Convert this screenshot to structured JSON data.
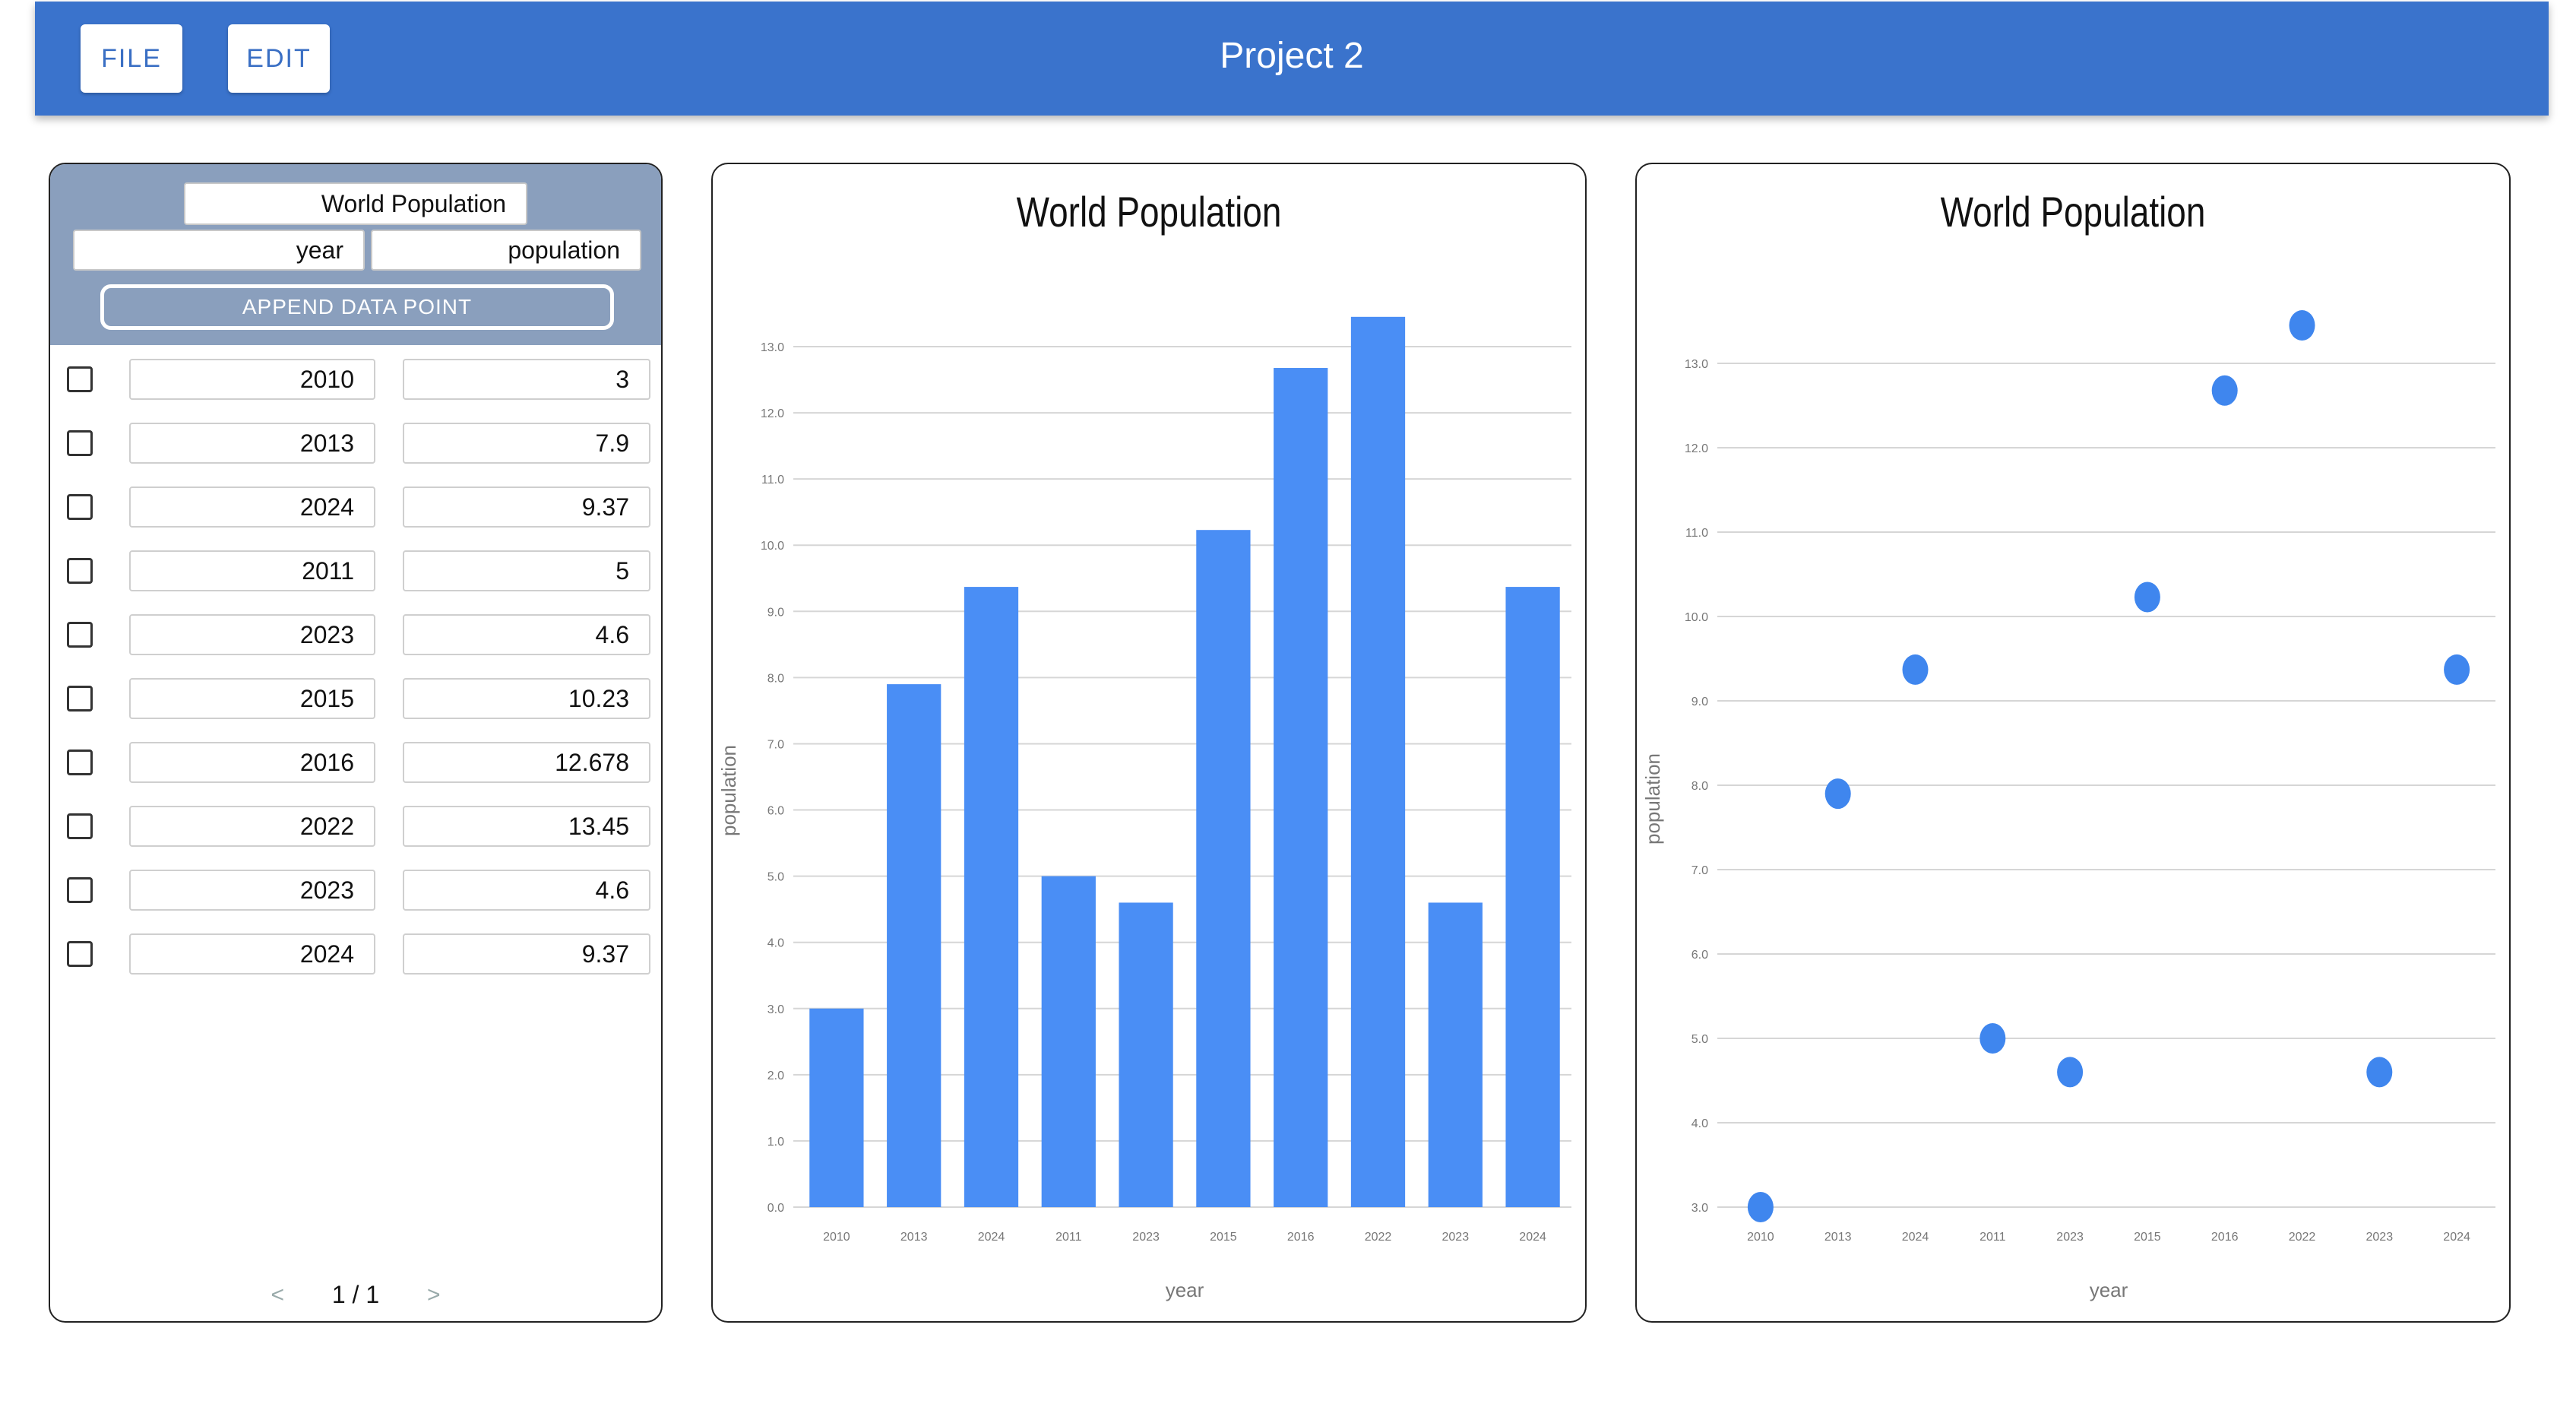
{
  "header": {
    "title": "Project 2",
    "menu": [
      {
        "label": "FILE"
      },
      {
        "label": "EDIT"
      }
    ]
  },
  "dataset": {
    "name": "World Population",
    "x_name": "year",
    "y_name": "population",
    "append_label": "APPEND DATA POINT",
    "rows": [
      {
        "x": "2010",
        "y": "3"
      },
      {
        "x": "2013",
        "y": "7.9"
      },
      {
        "x": "2024",
        "y": "9.37"
      },
      {
        "x": "2011",
        "y": "5"
      },
      {
        "x": "2023",
        "y": "4.6"
      },
      {
        "x": "2015",
        "y": "10.23"
      },
      {
        "x": "2016",
        "y": "12.678"
      },
      {
        "x": "2022",
        "y": "13.45"
      },
      {
        "x": "2023",
        "y": "4.6"
      },
      {
        "x": "2024",
        "y": "9.37"
      }
    ]
  },
  "pager": {
    "prev": "<",
    "page": "1 / 1",
    "next": ">"
  },
  "colors": {
    "accent": "#3a73cc",
    "bar": "#4a8ef5",
    "point": "#3f86ee",
    "header_panel": "#8a9fbd"
  },
  "chart_data": [
    {
      "type": "bar",
      "title": "World Population",
      "xlabel": "year",
      "ylabel": "population",
      "categories": [
        "2010",
        "2013",
        "2024",
        "2011",
        "2023",
        "2015",
        "2016",
        "2022",
        "2023",
        "2024"
      ],
      "values": [
        3,
        7.9,
        9.37,
        5,
        4.6,
        10.23,
        12.678,
        13.45,
        4.6,
        9.37
      ],
      "ylim": [
        0,
        13
      ],
      "yticks": [
        "0.0",
        "1.0",
        "2.0",
        "3.0",
        "4.0",
        "5.0",
        "6.0",
        "7.0",
        "8.0",
        "9.0",
        "10.0",
        "11.0",
        "12.0",
        "13.0"
      ],
      "grid": true
    },
    {
      "type": "scatter",
      "title": "World Population",
      "xlabel": "year",
      "ylabel": "population",
      "categories": [
        "2010",
        "2013",
        "2024",
        "2011",
        "2023",
        "2015",
        "2016",
        "2022",
        "2023",
        "2024"
      ],
      "values": [
        3,
        7.9,
        9.37,
        5,
        4.6,
        10.23,
        12.678,
        13.45,
        4.6,
        9.37
      ],
      "ylim": [
        3,
        13
      ],
      "yticks": [
        "3.0",
        "4.0",
        "5.0",
        "6.0",
        "7.0",
        "8.0",
        "9.0",
        "10.0",
        "11.0",
        "12.0",
        "13.0"
      ],
      "grid": true
    }
  ]
}
